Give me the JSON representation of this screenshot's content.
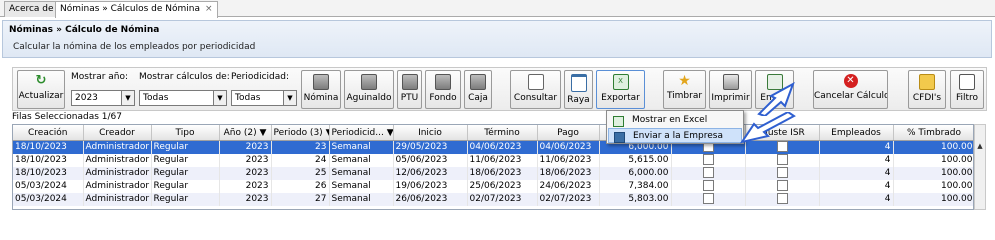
{
  "tabs": [
    {
      "label": "Acerca de"
    },
    {
      "label": "Nóminas » Cálculos de Nómina",
      "close": "×"
    }
  ],
  "header": {
    "title": "Nóminas » Cálculo de Nómina",
    "description": "Calcular la nómina de los empleados por periodicidad"
  },
  "toolbar": {
    "actualizar": "Actualizar",
    "mostrar_anio_label": "Mostrar año:",
    "mostrar_calculos_label": "Mostrar cálculos de:",
    "periodicidad_label": "Periodicidad:",
    "anio_value": "2023",
    "calculos_value": "Todas",
    "periodicidad_value": "Todas",
    "nomina": "Nómina",
    "aguinaldo": "Aguinaldo",
    "ptu": "PTU",
    "fondo": "Fondo",
    "caja": "Caja",
    "consultar": "Consultar",
    "raya": "Raya",
    "exportar": "Exportar",
    "timbrar": "Timbrar",
    "imprimir": "Imprimir",
    "enviar": "Enviar",
    "cancelar": "Cancelar Cálculo",
    "cfdis": "CFDI's",
    "filtro": "Filtro"
  },
  "grid": {
    "caption": "Filas Seleccionadas  1/67",
    "columns": [
      "Creación",
      "Creador",
      "Tipo",
      "Año (2)",
      "Periodo (3)",
      "Periodicid...",
      "Inicio",
      "Término",
      "Pago",
      "",
      "",
      "Ajuste ISR",
      "Empleados",
      "% Timbrado"
    ],
    "rows": [
      {
        "creacion": "18/10/2023",
        "creador": "Administrador",
        "tipo": "Regular",
        "anio": "2023",
        "periodo": "23",
        "periodicidad": "Semanal",
        "inicio": "29/05/2023",
        "termino": "04/06/2023",
        "pago": "04/06/2023",
        "monto": "6,000.00",
        "empleados": "4",
        "timbrado": "100.00"
      },
      {
        "creacion": "18/10/2023",
        "creador": "Administrador",
        "tipo": "Regular",
        "anio": "2023",
        "periodo": "24",
        "periodicidad": "Semanal",
        "inicio": "05/06/2023",
        "termino": "11/06/2023",
        "pago": "11/06/2023",
        "monto": "5,615.00",
        "empleados": "4",
        "timbrado": "100.00"
      },
      {
        "creacion": "18/10/2023",
        "creador": "Administrador",
        "tipo": "Regular",
        "anio": "2023",
        "periodo": "25",
        "periodicidad": "Semanal",
        "inicio": "12/06/2023",
        "termino": "18/06/2023",
        "pago": "18/06/2023",
        "monto": "6,000.00",
        "empleados": "4",
        "timbrado": "100.00"
      },
      {
        "creacion": "05/03/2024",
        "creador": "Administrador",
        "tipo": "Regular",
        "anio": "2023",
        "periodo": "26",
        "periodicidad": "Semanal",
        "inicio": "19/06/2023",
        "termino": "25/06/2023",
        "pago": "24/06/2023",
        "monto": "7,384.00",
        "empleados": "4",
        "timbrado": "100.00"
      },
      {
        "creacion": "05/03/2024",
        "creador": "Administrador",
        "tipo": "Regular",
        "anio": "2023",
        "periodo": "27",
        "periodicidad": "Semanal",
        "inicio": "26/06/2023",
        "termino": "02/07/2023",
        "pago": "02/07/2023",
        "monto": "5,803.00",
        "empleados": "4",
        "timbrado": "100.00"
      }
    ]
  },
  "menu": {
    "items": [
      {
        "label": "Mostrar en Excel"
      },
      {
        "label": "Enviar a la Empresa"
      }
    ]
  },
  "colors": {
    "selection": "#2f6bd1",
    "highlight": "#cfe2fa",
    "arrow": "#2f5fd0"
  }
}
